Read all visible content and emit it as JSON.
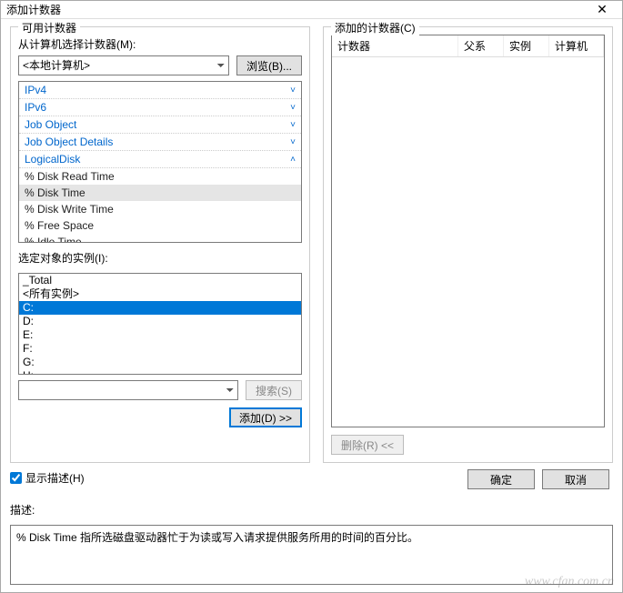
{
  "window": {
    "title": "添加计数器"
  },
  "left": {
    "legend": "可用计数器",
    "from_label": "从计算机选择计数器(M):",
    "computer_value": "<本地计算机>",
    "browse_btn": "浏览(B)...",
    "counters": [
      {
        "label": "IPv4",
        "type": "group",
        "chev": "down"
      },
      {
        "label": "IPv6",
        "type": "group",
        "chev": "down"
      },
      {
        "label": "Job Object",
        "type": "group",
        "chev": "down"
      },
      {
        "label": "Job Object Details",
        "type": "group",
        "chev": "down"
      },
      {
        "label": "LogicalDisk",
        "type": "group",
        "chev": "up"
      },
      {
        "label": "% Disk Read Time",
        "type": "child"
      },
      {
        "label": "% Disk Time",
        "type": "child",
        "selected": true
      },
      {
        "label": "% Disk Write Time",
        "type": "child"
      },
      {
        "label": "% Free Space",
        "type": "child"
      },
      {
        "label": "% Idle Time",
        "type": "child"
      }
    ],
    "instances_label": "选定对象的实例(I):",
    "instances": [
      {
        "label": "_Total"
      },
      {
        "label": "<所有实例>"
      },
      {
        "label": "C:",
        "selected": true
      },
      {
        "label": "D:"
      },
      {
        "label": "E:"
      },
      {
        "label": "F:"
      },
      {
        "label": "G:"
      },
      {
        "label": "H:"
      }
    ],
    "search_btn": "搜索(S)",
    "add_btn": "添加(D) >>"
  },
  "right": {
    "legend": "添加的计数器(C)",
    "cols": {
      "counter": "计数器",
      "parent": "父系",
      "instance": "实例",
      "computer": "计算机"
    },
    "remove_btn": "删除(R) <<"
  },
  "show_desc": {
    "label": "显示描述(H)",
    "checked": true
  },
  "buttons": {
    "ok": "确定",
    "cancel": "取消"
  },
  "desc": {
    "label": "描述:",
    "text": "% Disk Time 指所选磁盘驱动器忙于为读或写入请求提供服务所用的时间的百分比。"
  },
  "watermark": "www.cfan.com.cn"
}
